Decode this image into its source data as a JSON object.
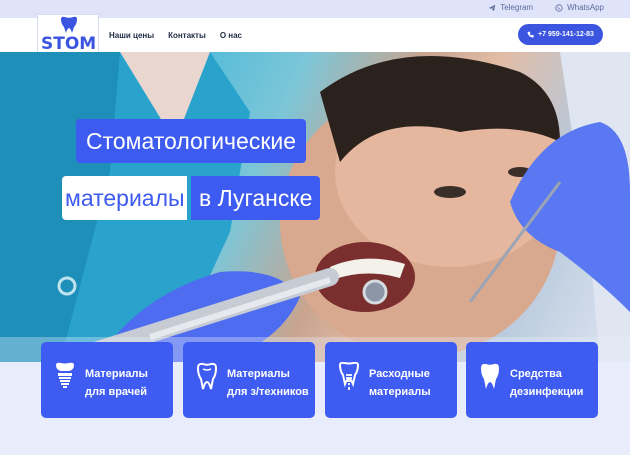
{
  "topbar": {
    "links": [
      {
        "label": "Telegram",
        "icon": "telegram-icon"
      },
      {
        "label": "WhatsApp",
        "icon": "whatsapp-icon"
      }
    ]
  },
  "header": {
    "logo_text": "STOM",
    "nav": [
      "Наши цены",
      "Контакты",
      "О нас"
    ],
    "phone": "+7 959-141-12-83",
    "accent_color": "#3b55e0"
  },
  "hero": {
    "title_line1": "Стоматологические",
    "title_line2_highlight": "материалы",
    "title_line2_rest": "в Луганске"
  },
  "cards": [
    {
      "line1": "Материалы",
      "line2": "для врачей",
      "icon": "dental-implant-icon"
    },
    {
      "line1": "Материалы",
      "line2": "для з/техников",
      "icon": "tooth-outline-icon"
    },
    {
      "line1": "Расходные",
      "line2": "материалы",
      "icon": "dental-implant-icon"
    },
    {
      "line1": "Средства",
      "line2": "дезинфекции",
      "icon": "tooth-icon"
    }
  ]
}
